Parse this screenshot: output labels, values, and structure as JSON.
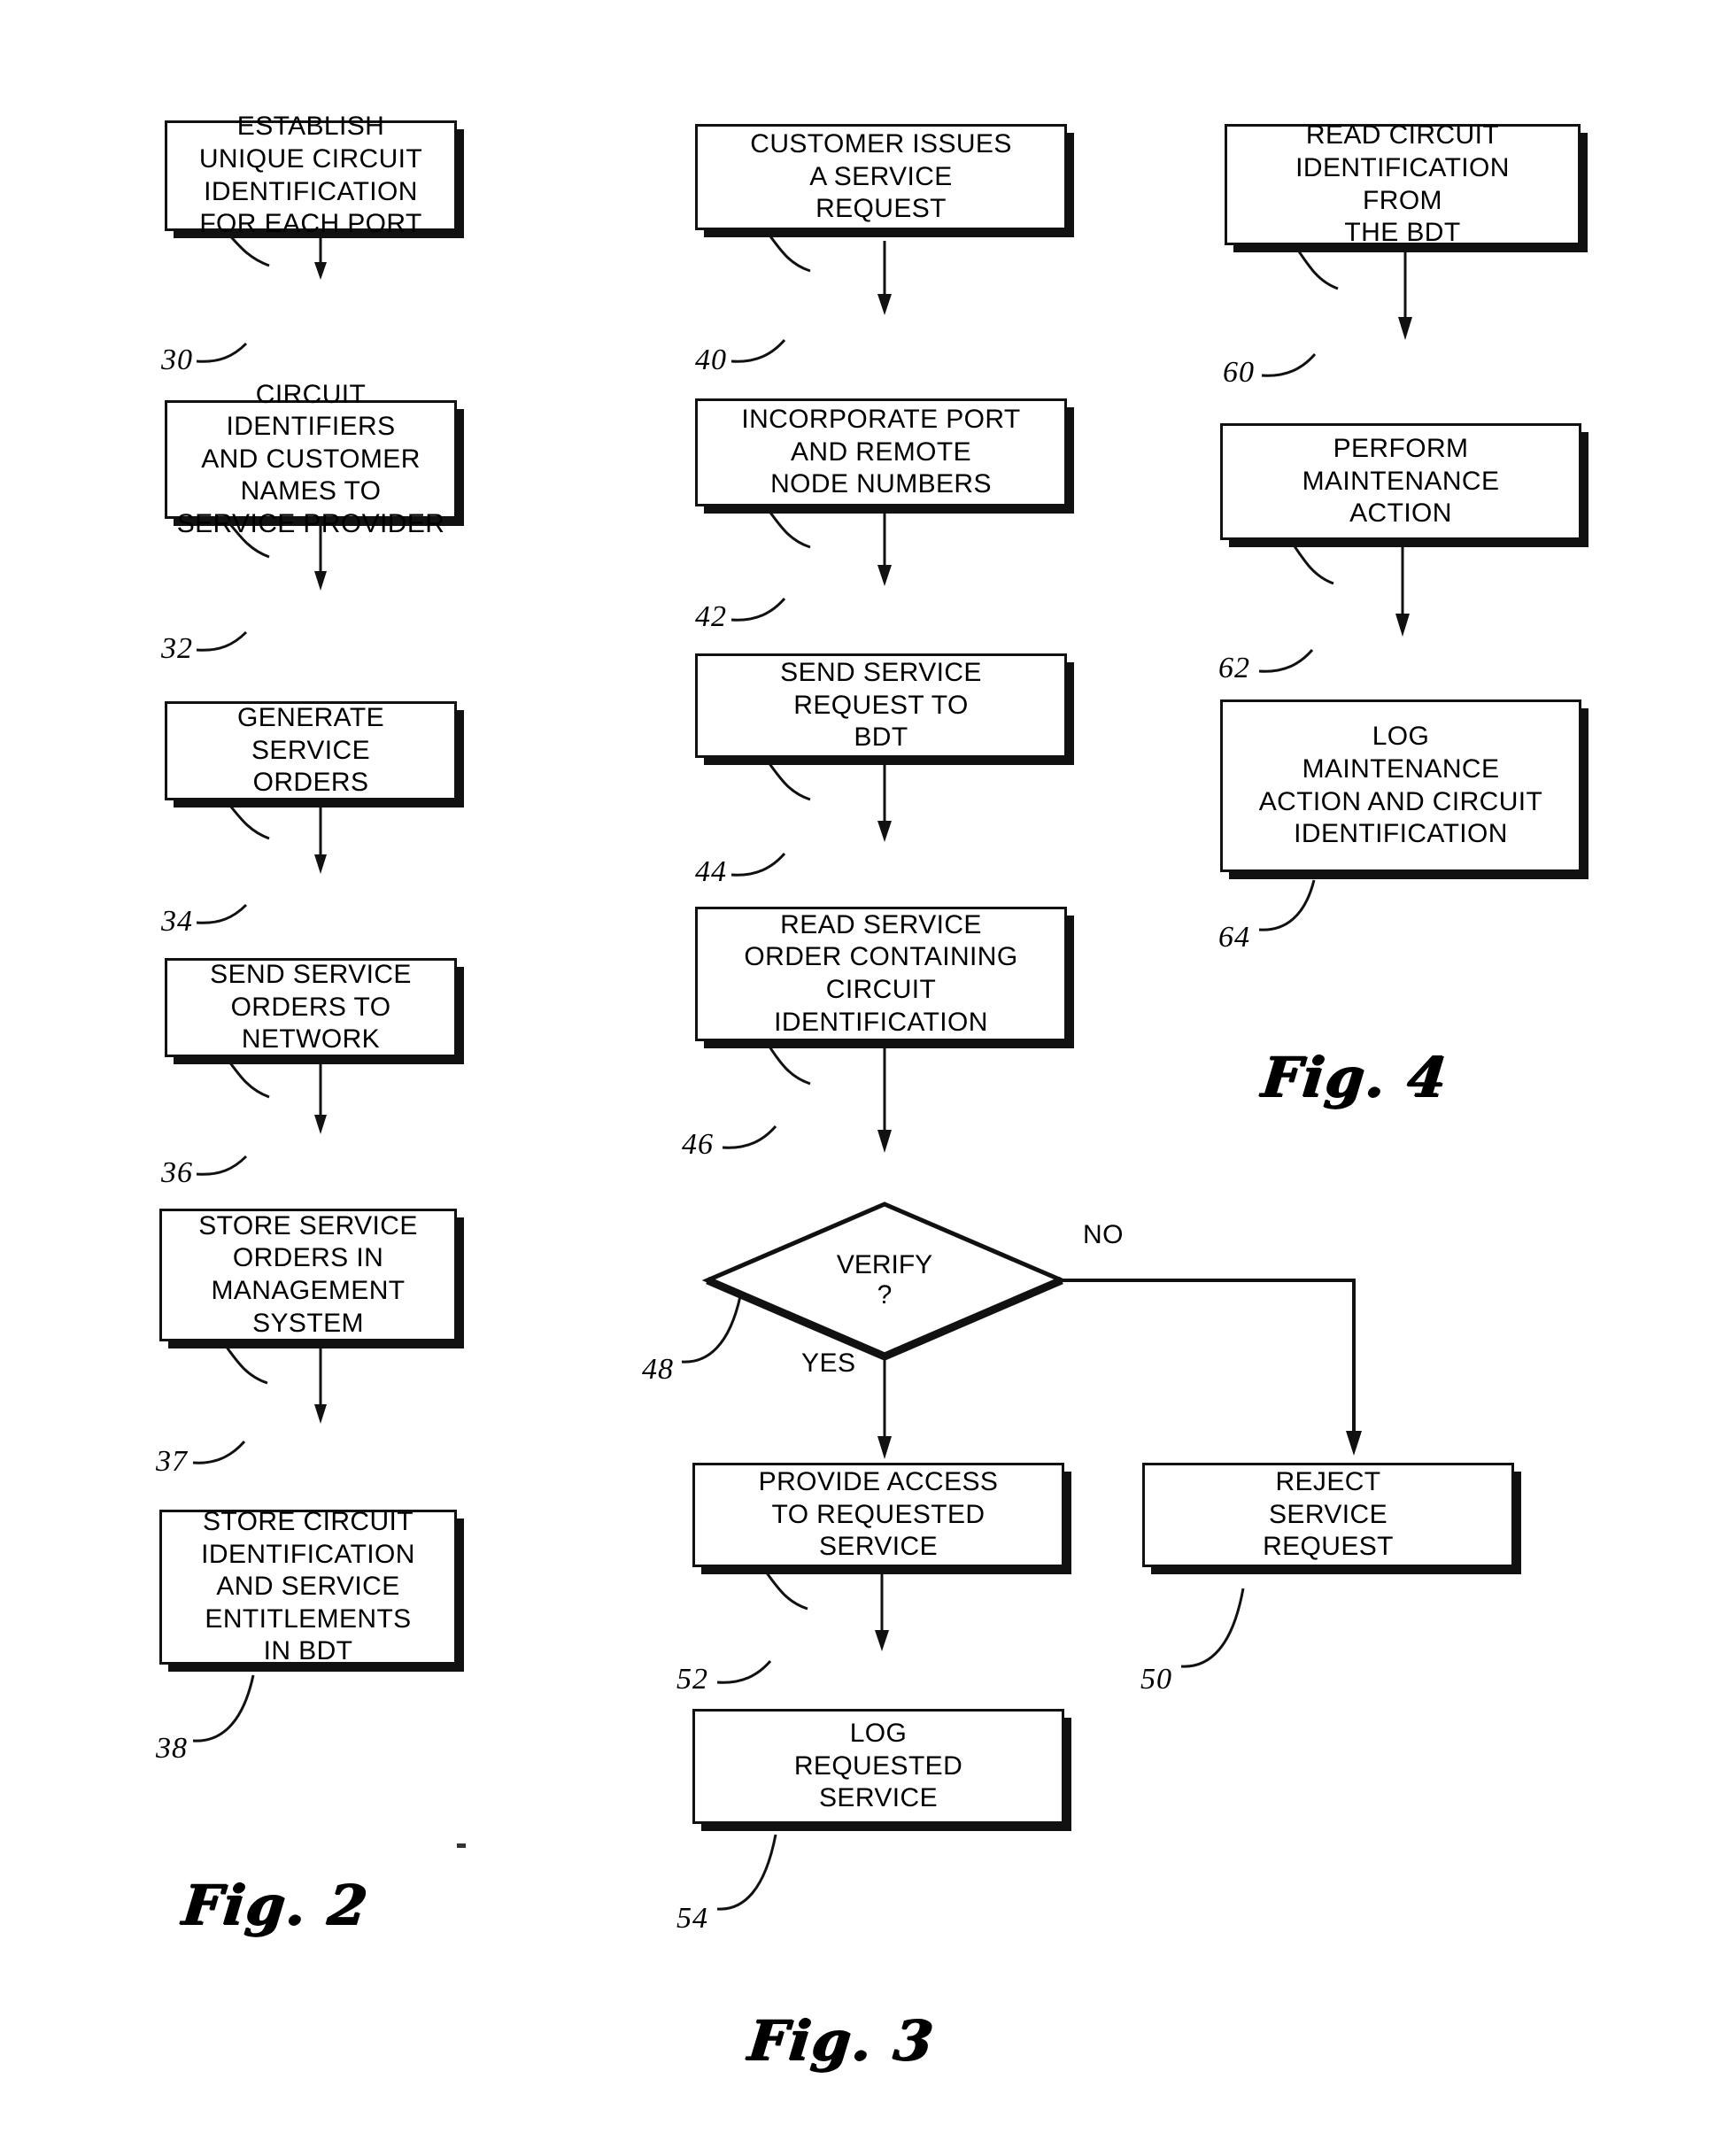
{
  "document": {
    "kind": "patent-flowchart-sheet",
    "figure_captions": [
      {
        "id": "fig2",
        "text": "Fig. 2"
      },
      {
        "id": "fig3",
        "text": "Fig. 3"
      },
      {
        "id": "fig4",
        "text": "Fig. 4"
      }
    ]
  },
  "fig2": {
    "caption": "Fig. 2",
    "nodes": [
      {
        "ref": "30",
        "text": "ESTABLISH\nUNIQUE CIRCUIT\nIDENTIFICATION\nFOR EACH PORT"
      },
      {
        "ref": "32",
        "text": "CIRCUIT IDENTIFIERS\nAND CUSTOMER\nNAMES TO\nSERVICE PROVIDER"
      },
      {
        "ref": "34",
        "text": "GENERATE\nSERVICE\nORDERS"
      },
      {
        "ref": "36",
        "text": "SEND SERVICE\nORDERS TO\nNETWORK"
      },
      {
        "ref": "37",
        "text": "STORE SERVICE\nORDERS IN\nMANAGEMENT\nSYSTEM"
      },
      {
        "ref": "38",
        "text": "STORE CIRCUIT\nIDENTIFICATION\nAND SERVICE\nENTITLEMENTS\nIN BDT"
      }
    ]
  },
  "fig3": {
    "caption": "Fig. 3",
    "nodes": [
      {
        "ref": "40",
        "text": "CUSTOMER ISSUES\nA SERVICE\nREQUEST"
      },
      {
        "ref": "42",
        "text": "INCORPORATE PORT\nAND REMOTE\nNODE NUMBERS"
      },
      {
        "ref": "44",
        "text": "SEND SERVICE\nREQUEST TO\nBDT"
      },
      {
        "ref": "46",
        "text": "READ SERVICE\nORDER CONTAINING\nCIRCUIT\nIDENTIFICATION"
      },
      {
        "ref": "52",
        "text": "PROVIDE ACCESS\nTO REQUESTED\nSERVICE"
      },
      {
        "ref": "54",
        "text": "LOG\nREQUESTED\nSERVICE"
      },
      {
        "ref": "50",
        "text": "REJECT\nSERVICE\nREQUEST"
      }
    ],
    "decision": {
      "ref": "48",
      "line1": "VERIFY",
      "line2": "?",
      "yes_label": "YES",
      "no_label": "NO"
    }
  },
  "fig4": {
    "caption": "Fig. 4",
    "nodes": [
      {
        "ref": "60",
        "text": "READ CIRCUIT\nIDENTIFICATION\nFROM\nTHE BDT"
      },
      {
        "ref": "62",
        "text": "PERFORM\nMAINTENANCE\nACTION"
      },
      {
        "ref": "64",
        "text": "LOG\nMAINTENANCE\nACTION AND CIRCUIT\nIDENTIFICATION"
      }
    ]
  },
  "colors": {
    "ink": "#111111",
    "paper": "#ffffff"
  }
}
